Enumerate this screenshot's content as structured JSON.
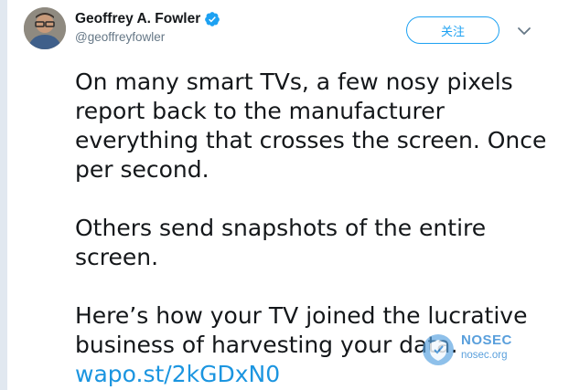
{
  "author": {
    "display_name": "Geoffrey A. Fowler",
    "handle": "@geoffreyfowler",
    "verified": true,
    "verified_icon": "verified-badge-icon"
  },
  "actions": {
    "follow_label": "关注",
    "menu_icon": "chevron-down-icon"
  },
  "tweet": {
    "paragraphs": [
      "On many smart TVs, a few nosy pixels report back to the manufacturer everything that crosses the screen. Once per second.",
      "Others send snapshots of the entire screen.",
      "Here’s how your TV joined the lucrative business of harvesting your data."
    ],
    "link_text": "wapo.st/2kGDxN0"
  },
  "watermark": {
    "title": "NOSEC",
    "subtitle": "nosec.org"
  },
  "colors": {
    "accent": "#1da1f2",
    "link": "#1b95e0",
    "text": "#14171a",
    "muted": "#657786"
  }
}
